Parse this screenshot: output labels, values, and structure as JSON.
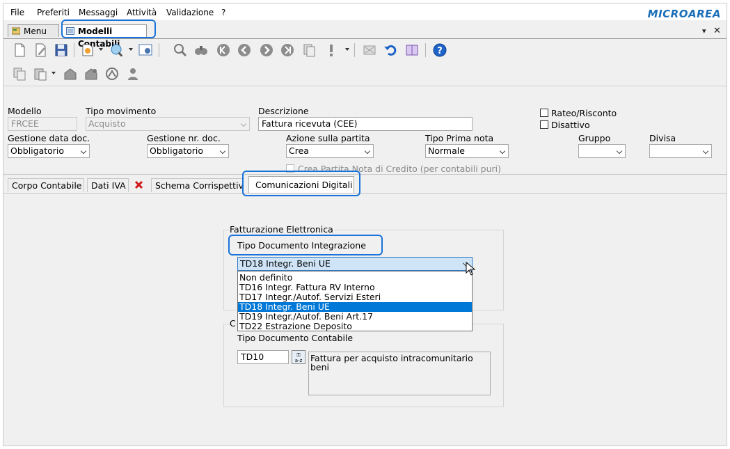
{
  "menubar": {
    "items": [
      "File",
      "Preferiti",
      "Messaggi",
      "Attività",
      "Validazione",
      "?"
    ],
    "logo": "MICROAREA"
  },
  "doc_tabs": [
    {
      "label": "Menu"
    },
    {
      "label": "Modelli Contabili"
    }
  ],
  "window_controls": {
    "dropdown": "▾",
    "close": "✕"
  },
  "form": {
    "modello": {
      "label": "Modello",
      "value": "FRCEE"
    },
    "tipo_movimento": {
      "label": "Tipo movimento",
      "value": "Acquisto"
    },
    "descrizione": {
      "label": "Descrizione",
      "value": "Fattura ricevuta (CEE)"
    },
    "rateo_risconto": {
      "label": "Rateo/Risconto",
      "checked": false
    },
    "disattivo": {
      "label": "Disattivo",
      "checked": false
    },
    "gestione_data_doc": {
      "label": "Gestione data doc.",
      "value": "Obbligatorio"
    },
    "gestione_nr_doc": {
      "label": "Gestione nr. doc.",
      "value": "Obbligatorio"
    },
    "azione_partita": {
      "label": "Azione sulla partita",
      "value": "Crea"
    },
    "tipo_prima_nota": {
      "label": "Tipo Prima nota",
      "value": "Normale"
    },
    "gruppo": {
      "label": "Gruppo",
      "value": ""
    },
    "divisa": {
      "label": "Divisa",
      "value": ""
    },
    "crea_partita_nc": {
      "label": "Crea Partita Nota di Credito (per contabili puri)",
      "checked": false
    }
  },
  "page_tabs": [
    {
      "label": "Corpo Contabile"
    },
    {
      "label": "Dati IVA"
    },
    {
      "label": "Schema Corrispettiv"
    },
    {
      "label": "Comunicazioni Digitali"
    }
  ],
  "fattura_elettronica": {
    "group_title": "Fatturazione Elettronica",
    "tipo_doc_integrazione_label": "Tipo Documento Integrazione",
    "selected": "TD18 Integr. Beni UE",
    "options": [
      "Non definito",
      "TD16 Integr. Fattura RV Interno",
      "TD17 Integr./Autof. Servizi Esteri",
      "TD18 Integr. Beni UE",
      "TD19 Integr./Autof. Beni Art.17",
      "TD22 Estrazione Deposito"
    ],
    "selected_index": 3
  },
  "comunicazioni": {
    "group_title_fragment": "C",
    "tipo_doc_contabile_label": "Tipo Documento Contabile",
    "code": "TD10",
    "lookup_button": "a-z",
    "description_line1": "Fattura per acquisto intracomunitario",
    "description_line2": "beni"
  },
  "colors": {
    "highlight": "#1a73d8",
    "selection": "#0078d7",
    "logo": "#1b6fb8",
    "window_bg": "#f0f0f0"
  }
}
